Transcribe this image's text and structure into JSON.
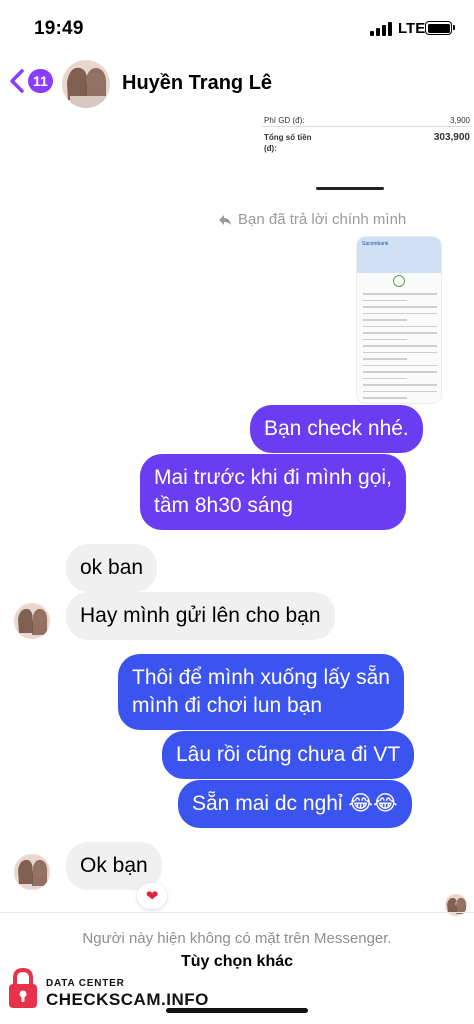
{
  "status_bar": {
    "time": "19:49",
    "network": "LTE"
  },
  "header": {
    "back_count": "11",
    "contact_name": "Huyền Trang Lê"
  },
  "receipt_top": {
    "fee_label": "Phí GD (đ):",
    "fee_value": "3,900",
    "total_label": "Tổng số tiền (đ):",
    "total_value": "303,900"
  },
  "reply_note": "Bạn đã trả lời chính mình",
  "receipt_image": {
    "bank": "Sacombank",
    "status": "Giao dịch thành công"
  },
  "messages": [
    {
      "direction": "out",
      "text": "Bạn check nhé."
    },
    {
      "direction": "out",
      "text_lines": [
        "Mai trước khi đi mình gọi,",
        "tầm 8h30 sáng"
      ]
    },
    {
      "direction": "in",
      "text": "ok ban"
    },
    {
      "direction": "in",
      "text": "Hay mình gửi lên cho bạn"
    },
    {
      "direction": "out",
      "text_lines": [
        "Thôi để mình xuống lấy sẵn",
        "mình đi chơi lun bạn"
      ]
    },
    {
      "direction": "out",
      "text": "Lâu rồi cũng chưa đi VT"
    },
    {
      "direction": "out",
      "text": "Sẵn mai dc nghỉ 😂😂"
    },
    {
      "direction": "in",
      "text": "Ok bạn",
      "reaction": "❤"
    }
  ],
  "footer": {
    "note": "Người này hiện không có mặt trên Messenger.",
    "option": "Tùy chọn khác"
  },
  "watermark": {
    "line1": "DATA CENTER",
    "line2": "CHECKSCAM.INFO"
  },
  "colors": {
    "outgoing": "#6a3df2",
    "outgoing_alt": "#3b54f0",
    "incoming": "#f0f0f0",
    "accent": "#8b3dff"
  }
}
